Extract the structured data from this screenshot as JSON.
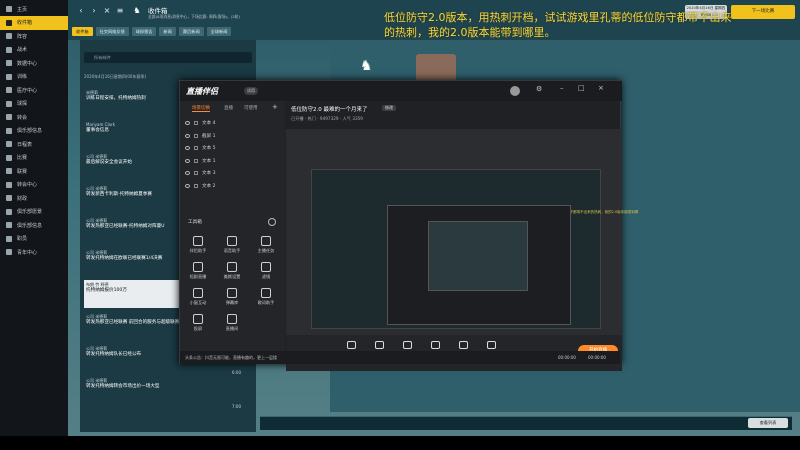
{
  "nav": {
    "items": [
      "主页",
      "收件箱",
      "阵容",
      "战术",
      "数据中心",
      "训练",
      "医疗中心",
      "球探",
      "转会",
      "俱乐部信息",
      "日程表",
      "比赛",
      "联赛",
      "转会中心",
      "财政",
      "俱乐部愿景",
      "俱乐部信息",
      "职员",
      "青年中心"
    ],
    "active_index": 1
  },
  "topbar": {
    "title": "收件箱",
    "subtitle": "全部(8项消息/消息中心，下场比赛: 周四(客场)，(2轮)",
    "tabs": [
      "收件箱",
      "社交网络反馈",
      "球探报告",
      "新闻",
      "赛后新闻",
      "全球新闻"
    ],
    "active_tab": 0,
    "date": "2020年4月16日 星期四 09:00",
    "next_label": "下一场比赛"
  },
  "overlay_text": "低位防守2.0版本，用热刺开档，试试游戏里孔蒂的低位防守都带不出来的热刺，我的2.0版本能带到哪里。",
  "inbox": {
    "search_placeholder": "所有邮件",
    "date_header": "2020年4月16日星期四(00年赛季)",
    "messages": [
      {
        "from": "米德莉",
        "text": "训练日程安排，托特纳姆热刺"
      },
      {
        "from": "Mariyam Clark",
        "text": "董事会信息"
      },
      {
        "from": "公司 米德莉",
        "text": "最后解说安全会议开始"
      },
      {
        "from": "公司 米德莉",
        "text": "转发新西卡利斯-托特纳姆夏季赛"
      },
      {
        "from": "公司 米德莉",
        "text": "转发热那亚已经联赛-托特纳姆对阵曼U"
      },
      {
        "from": "公司 米德莉",
        "text": "转发托特纳姆在欧联已经联赛1/4决赛"
      },
      {
        "from": "布朗 劳 释德",
        "text": "托特纳姆报价100万"
      },
      {
        "from": "公司 米德莉",
        "text": "转发热那亚已经联赛 前回合的服务与超级联赛"
      },
      {
        "from": "公司 米德莉",
        "text": "转发托特纳姆队长已经公布"
      },
      {
        "from": "公司 米德莉",
        "text": "转发托特纳姆转会市场出价一场大型"
      }
    ],
    "selected_index": 6,
    "times": [
      "6:00",
      "7:00"
    ]
  },
  "back_label": "查看列表",
  "stream": {
    "logo": "直播伴侣",
    "version": "试用",
    "left_tabs": [
      "场景切换",
      "直播",
      "可使用"
    ],
    "scenes": [
      "文本 4",
      "截屏 1",
      "文本 5",
      "文本 1",
      "文本 3",
      "文本 2"
    ],
    "tools_label": "工具箱",
    "tools": [
      "伴侣助手",
      "语音助手",
      "主播任务",
      "短剧直播",
      "美颜设置",
      "滤镜",
      "小窗互动",
      "弹幕库",
      "歌词助手",
      "投屏",
      "直播间"
    ],
    "heading": "低位防守2.0 最难的一个月来了",
    "heading_badge": "修改",
    "room_info": "已开播 · 热门 · 9497329 · 人气 3359",
    "preview_text": "低位防守2.0版本，用热刺开档，试试游戏里孔蒂的低位防守都带不出来的热刺，我的2.0版本能带到哪里。",
    "bottom_tools": [
      "直播屏幕",
      "摄像头",
      "手机投屏",
      "多媒体",
      "麦克风",
      "扬声器"
    ],
    "live_label": "开始直播",
    "status": "头条公告：抖音无限可能，直播有趣的，更上一层楼",
    "time1": "00:00:00",
    "time2": "00:00:00"
  }
}
